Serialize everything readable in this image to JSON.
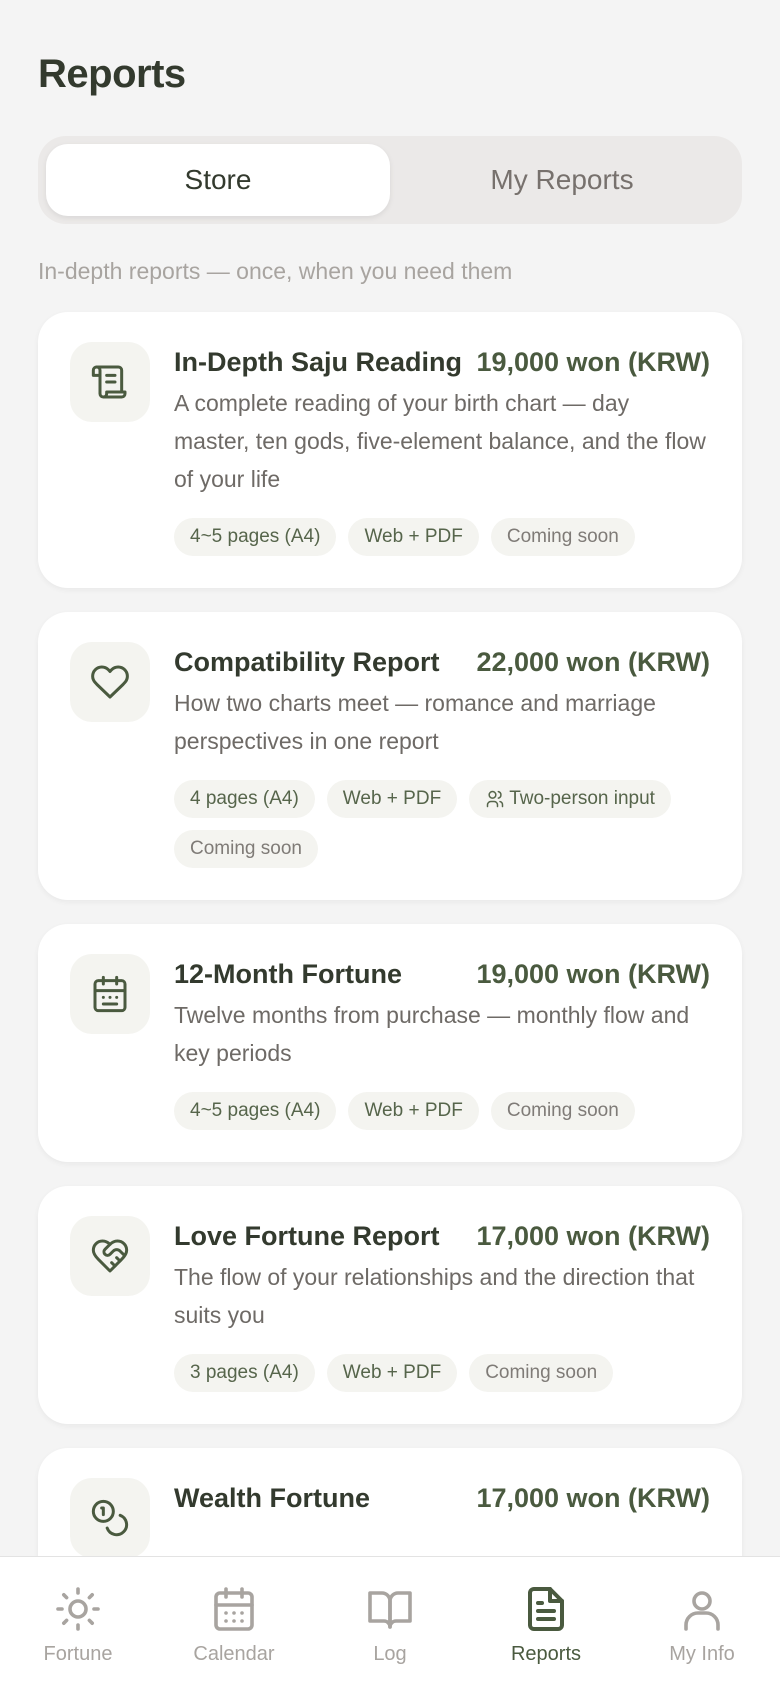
{
  "header": {
    "title": "Reports"
  },
  "segments": {
    "store": "Store",
    "my_reports": "My Reports"
  },
  "subtitle": "In-depth reports — once, when you need them",
  "reports": [
    {
      "name": "In-Depth Saju Reading",
      "price": "19,000 won (KRW)",
      "description": "A complete reading of your birth chart — day master, ten gods, five-element balance, and the flow of your life",
      "tags": [
        "4~5 pages (A4)",
        "Web + PDF",
        "Coming soon"
      ]
    },
    {
      "name": "Compatibility Report",
      "price": "22,000 won (KRW)",
      "description": "How two charts meet — romance and marriage perspectives in one report",
      "tags": [
        "4 pages (A4)",
        "Web + PDF",
        "Two-person input",
        "Coming soon"
      ]
    },
    {
      "name": "12-Month Fortune",
      "price": "19,000 won (KRW)",
      "description": "Twelve months from purchase — monthly flow and key periods",
      "tags": [
        "4~5 pages (A4)",
        "Web + PDF",
        "Coming soon"
      ]
    },
    {
      "name": "Love Fortune Report",
      "price": "17,000 won (KRW)",
      "description": "The flow of your relationships and the direction that suits you",
      "tags": [
        "3 pages (A4)",
        "Web + PDF",
        "Coming soon"
      ]
    },
    {
      "name": "Wealth Fortune",
      "price": "17,000 won (KRW)"
    }
  ],
  "nav": {
    "fortune": "Fortune",
    "calendar": "Calendar",
    "log": "Log",
    "reports": "Reports",
    "my_info": "My Info"
  },
  "colors": {
    "accent": "#4a5a3f",
    "text_dark": "#333a2e",
    "muted": "#a8a4a0",
    "background": "#f4f4f4"
  }
}
